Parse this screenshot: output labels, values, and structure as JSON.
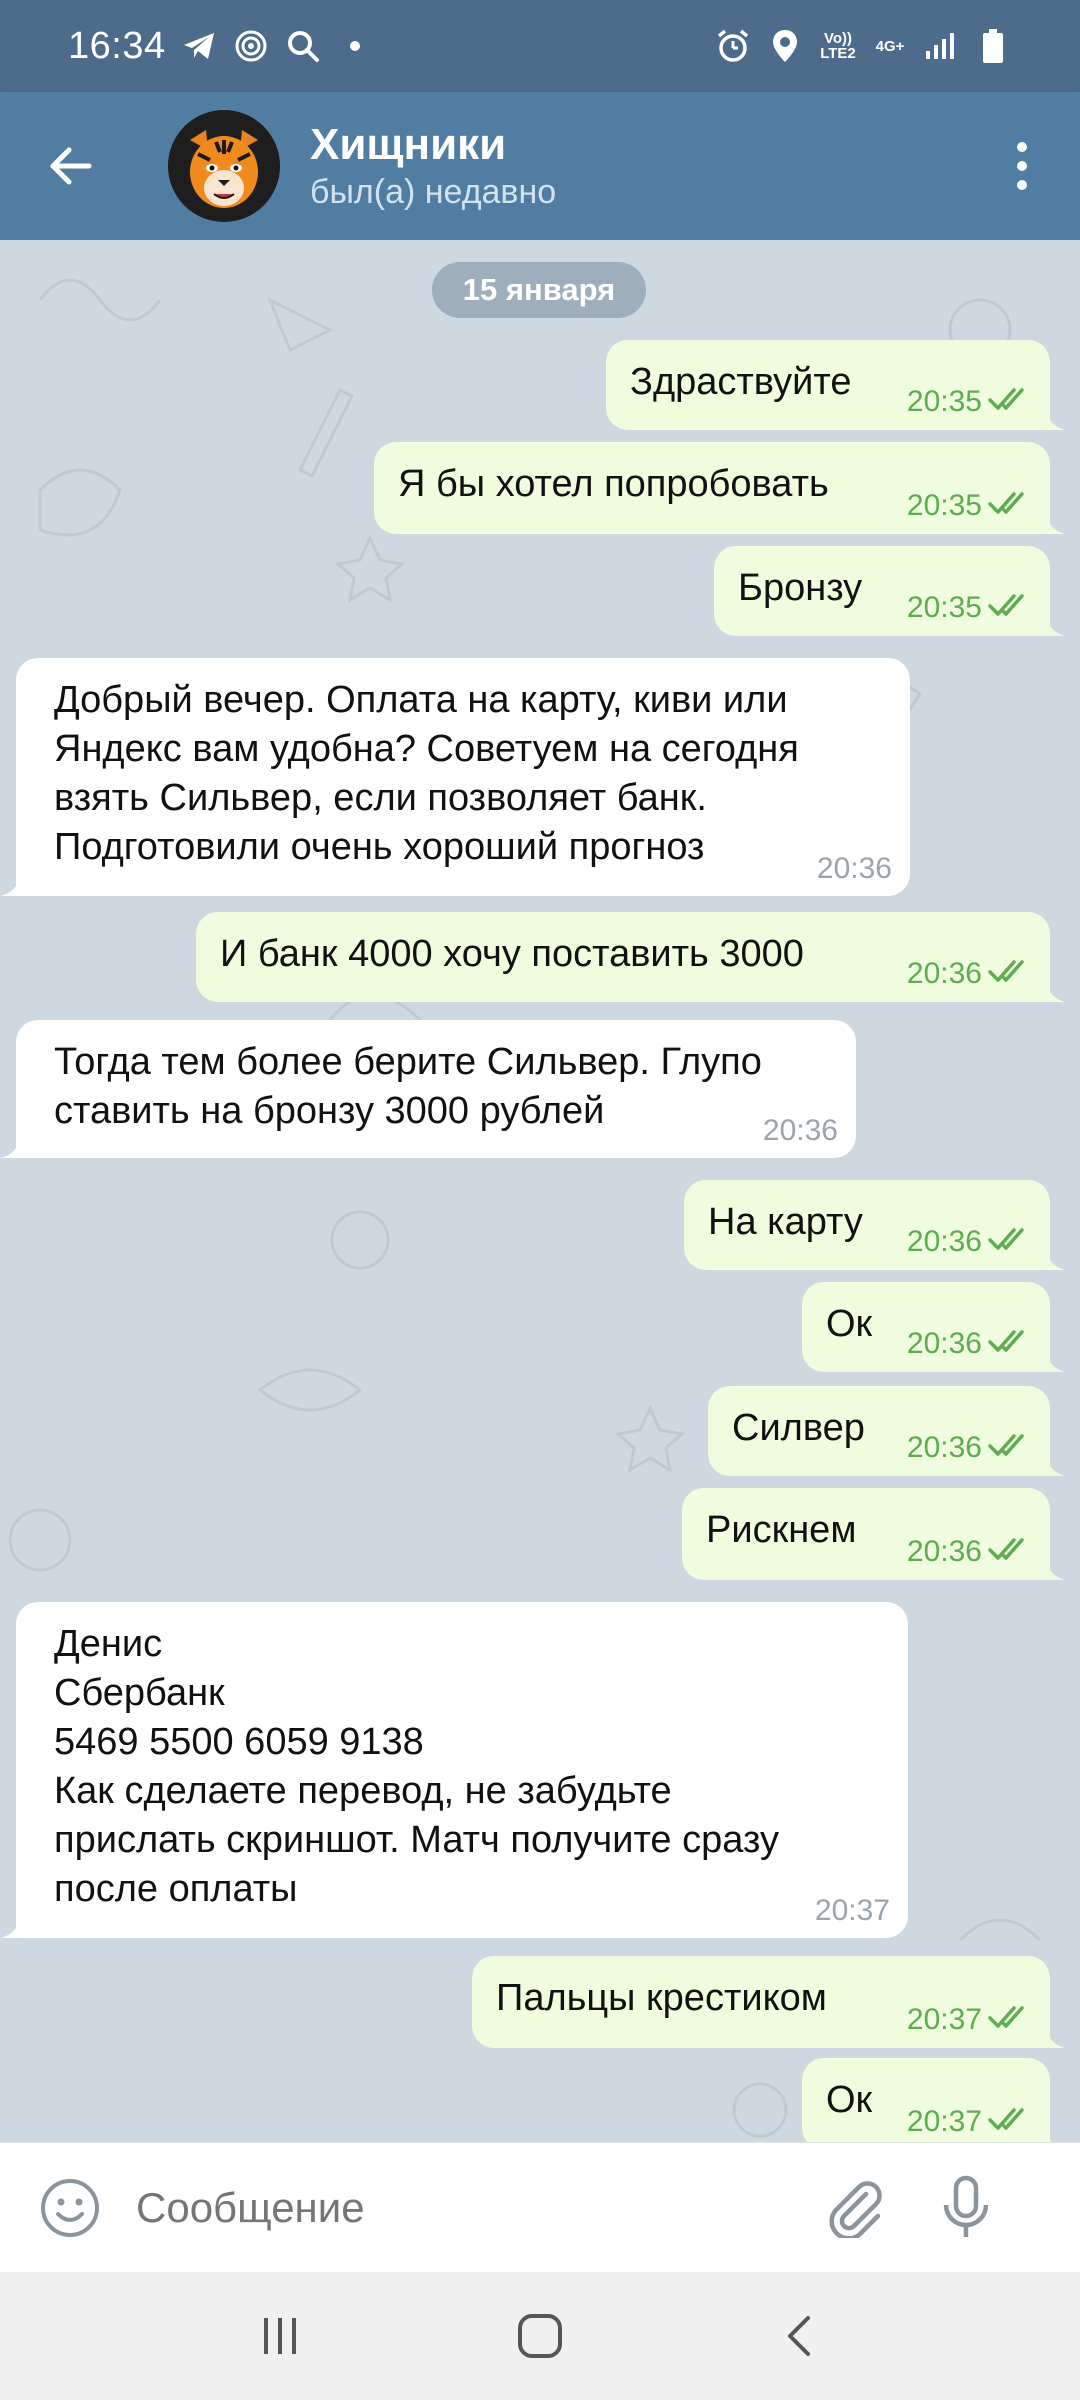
{
  "status_bar": {
    "time": "16:34",
    "left_icons": [
      "telegram-icon",
      "spiral-icon",
      "search-icon",
      "dot-icon"
    ],
    "right_icons": [
      "alarm-icon",
      "location-icon",
      "volte-icon",
      "4g-icon",
      "signal-icon",
      "battery-icon"
    ],
    "volte_text": "Vo)) LTE2",
    "network_text": "4G+"
  },
  "header": {
    "title": "Хищники",
    "status": "был(а) недавно"
  },
  "date_separator": "15 января",
  "messages": [
    {
      "dir": "out",
      "text": "Здраствуйте",
      "time": "20:35",
      "read": true
    },
    {
      "dir": "out",
      "text": "Я бы хотел попробовать",
      "time": "20:35",
      "read": true
    },
    {
      "dir": "out",
      "text": "Бронзу",
      "time": "20:35",
      "read": true
    },
    {
      "dir": "in",
      "text": "Добрый вечер. Оплата на карту, киви или\nЯндекс вам удобна? Советуем на сегодня\nвзять Сильвер, если позволяет банк.\nПодготовили очень хороший прогноз",
      "time": "20:36"
    },
    {
      "dir": "out",
      "text": "И банк 4000 хочу поставить 3000",
      "time": "20:36",
      "read": true
    },
    {
      "dir": "in",
      "text": "Тогда тем более берите Сильвер. Глупо\nставить на бронзу 3000 рублей",
      "time": "20:36"
    },
    {
      "dir": "out",
      "text": "На карту",
      "time": "20:36",
      "read": true
    },
    {
      "dir": "out",
      "text": "Ок",
      "time": "20:36",
      "read": true
    },
    {
      "dir": "out",
      "text": "Силвер",
      "time": "20:36",
      "read": true
    },
    {
      "dir": "out",
      "text": "Рискнем",
      "time": "20:36",
      "read": true
    },
    {
      "dir": "in",
      "text": "Денис\nСбербанк\n5469 5500 6059 9138\nКак сделаете перевод, не забудьте\nприслать скриншот. Матч получите сразу\nпосле оплаты",
      "time": "20:37"
    },
    {
      "dir": "out",
      "text": "Пальцы крестиком",
      "time": "20:37",
      "read": true
    },
    {
      "dir": "out",
      "text": "Ок",
      "time": "20:37",
      "read": true
    }
  ],
  "input": {
    "placeholder": "Сообщение"
  },
  "colors": {
    "header": "#527da3",
    "status_bar": "#4d6b8a",
    "outgoing_bubble": "#effdde",
    "incoming_bubble": "#ffffff",
    "check_color": "#5fab4f",
    "chat_background": "#cdd8e1"
  }
}
